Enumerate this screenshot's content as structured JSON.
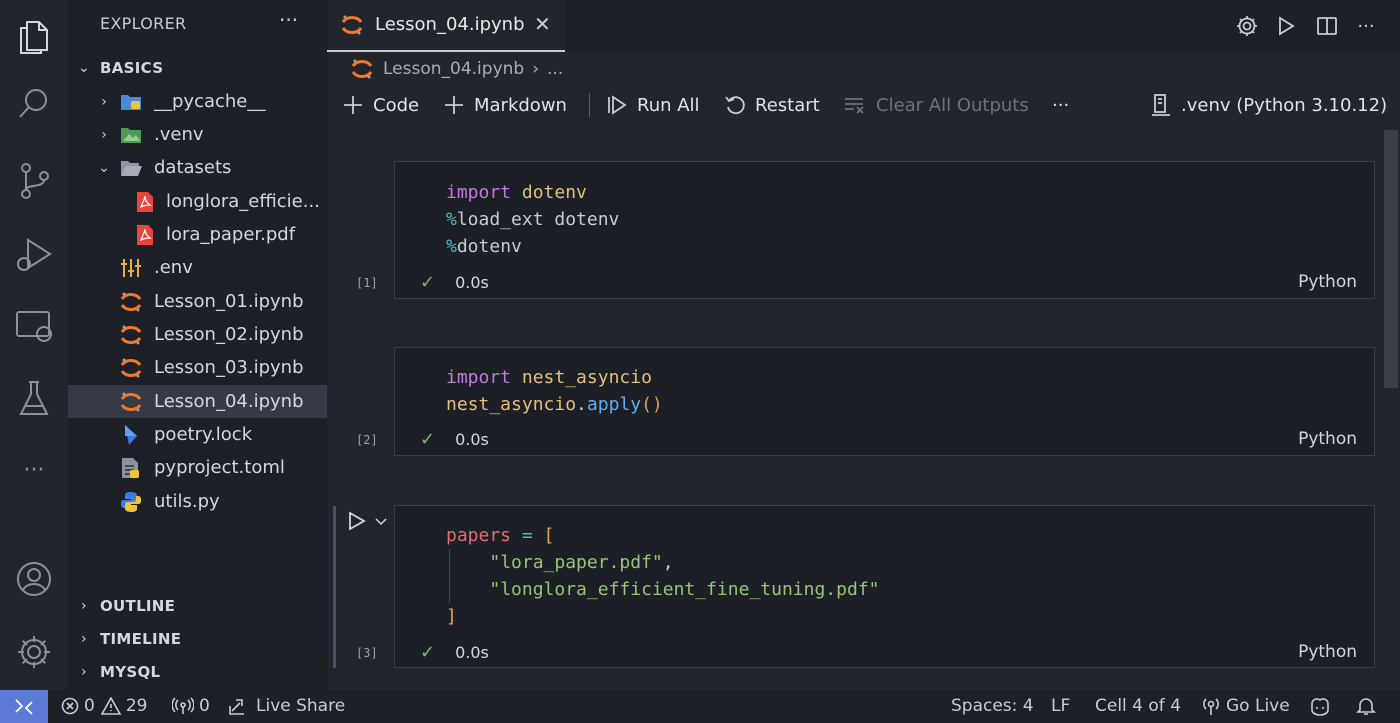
{
  "explorer": {
    "title": "EXPLORER",
    "more": "···",
    "folder": "BASICS",
    "items": [
      {
        "label": "__pycache__",
        "type": "folder",
        "icon": "python-folder-icon"
      },
      {
        "label": ".venv",
        "type": "folder",
        "icon": "env-folder-icon"
      },
      {
        "label": "datasets",
        "type": "folder-open",
        "icon": "folder-open-icon"
      },
      {
        "label": "longlora_efficie...",
        "type": "file",
        "icon": "pdf-icon"
      },
      {
        "label": "lora_paper.pdf",
        "type": "file",
        "icon": "pdf-icon"
      },
      {
        "label": ".env",
        "type": "file",
        "icon": "settings-file-icon"
      },
      {
        "label": "Lesson_01.ipynb",
        "type": "file",
        "icon": "jupyter-icon"
      },
      {
        "label": "Lesson_02.ipynb",
        "type": "file",
        "icon": "jupyter-icon"
      },
      {
        "label": "Lesson_03.ipynb",
        "type": "file",
        "icon": "jupyter-icon"
      },
      {
        "label": "Lesson_04.ipynb",
        "type": "file",
        "icon": "jupyter-icon",
        "selected": true
      },
      {
        "label": "poetry.lock",
        "type": "file",
        "icon": "poetry-icon"
      },
      {
        "label": "pyproject.toml",
        "type": "file",
        "icon": "toml-icon"
      },
      {
        "label": "utils.py",
        "type": "file",
        "icon": "python-icon"
      }
    ],
    "sections": [
      "OUTLINE",
      "TIMELINE",
      "MYSQL"
    ]
  },
  "tab": {
    "label": "Lesson_04.ipynb",
    "close": "✕"
  },
  "breadcrumb": {
    "file": "Lesson_04.ipynb",
    "sep": "›",
    "more": "..."
  },
  "toolbar": {
    "code": "Code",
    "markdown": "Markdown",
    "run_all": "Run All",
    "restart": "Restart",
    "clear_outputs": "Clear All Outputs",
    "more": "···",
    "kernel": ".venv (Python 3.10.12)"
  },
  "cells": [
    {
      "number": "[1]",
      "time": "0.0s",
      "language": "Python"
    },
    {
      "number": "[2]",
      "time": "0.0s",
      "language": "Python"
    },
    {
      "number": "[3]",
      "time": "0.0s",
      "language": "Python"
    }
  ],
  "code": {
    "c1_l1_kw": "import",
    "c1_l1_mod": " dotenv",
    "c1_l2_mag": "%",
    "c1_l2_rest": "load_ext dotenv",
    "c1_l3_mag": "%",
    "c1_l3_rest": "dotenv",
    "c2_l1_kw": "import",
    "c2_l1_mod": " nest_asyncio",
    "c2_l2_mod": "nest_asyncio",
    "c2_l2_dot": ".",
    "c2_l2_fn": "apply",
    "c2_l2_paren": "()",
    "c3_l1_var": "papers",
    "c3_l1_eq": " = ",
    "c3_l1_brk": "[",
    "c3_l2_str": "\"lora_paper.pdf\"",
    "c3_l2_comma": ",",
    "c3_l3_str": "\"longlora_efficient_fine_tuning.pdf\"",
    "c3_l4_brk": "]"
  },
  "status": {
    "errors": "0",
    "warnings": "29",
    "ports": "0",
    "live_share": "Live Share",
    "spaces": "Spaces: 4",
    "eol": "LF",
    "cell": "Cell 4 of 4",
    "go_live": "Go Live"
  },
  "colors": {
    "accent_remote": "#5b7bd6",
    "jupyter_orange": "#f37726",
    "check_green": "#7ab86a"
  }
}
